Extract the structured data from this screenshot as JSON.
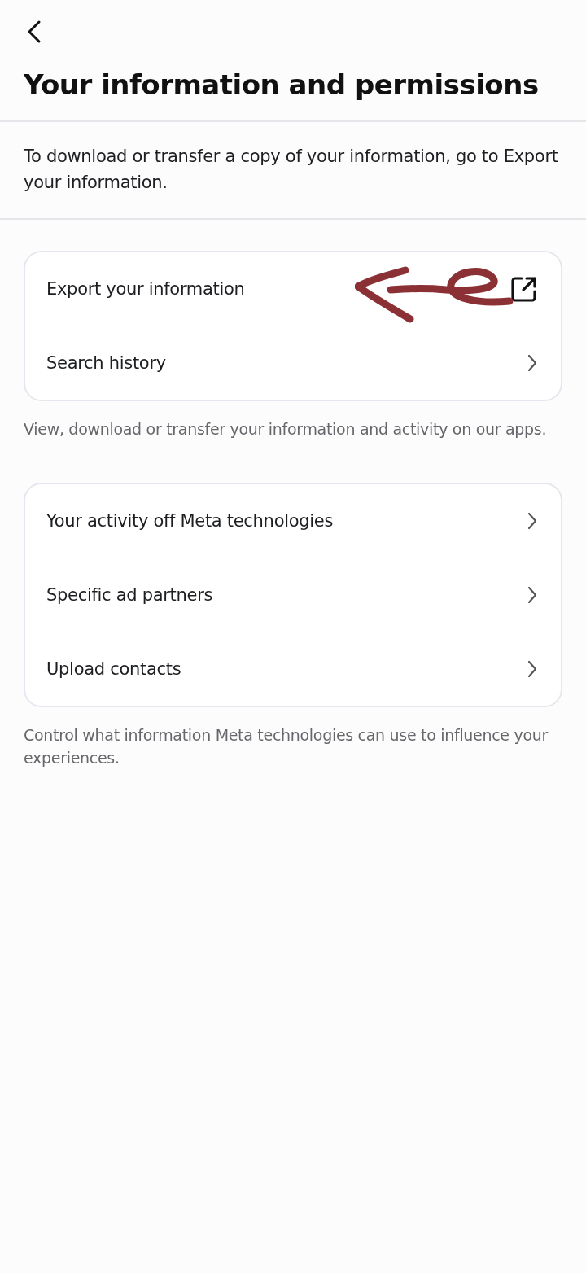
{
  "header": {
    "title": "Your information and permissions"
  },
  "intro": "To download or transfer a copy of your information, go to Export your information.",
  "sections": [
    {
      "items": [
        {
          "label": "Export your information",
          "kind": "external"
        },
        {
          "label": "Search history",
          "kind": "chevron"
        }
      ],
      "footer": "View, download or transfer your information and activity on our apps."
    },
    {
      "items": [
        {
          "label": "Your activity off Meta technologies",
          "kind": "chevron"
        },
        {
          "label": "Specific ad partners",
          "kind": "chevron"
        },
        {
          "label": "Upload contacts",
          "kind": "chevron"
        }
      ],
      "footer": "Control what information Meta technologies can use to influence your experiences."
    }
  ]
}
